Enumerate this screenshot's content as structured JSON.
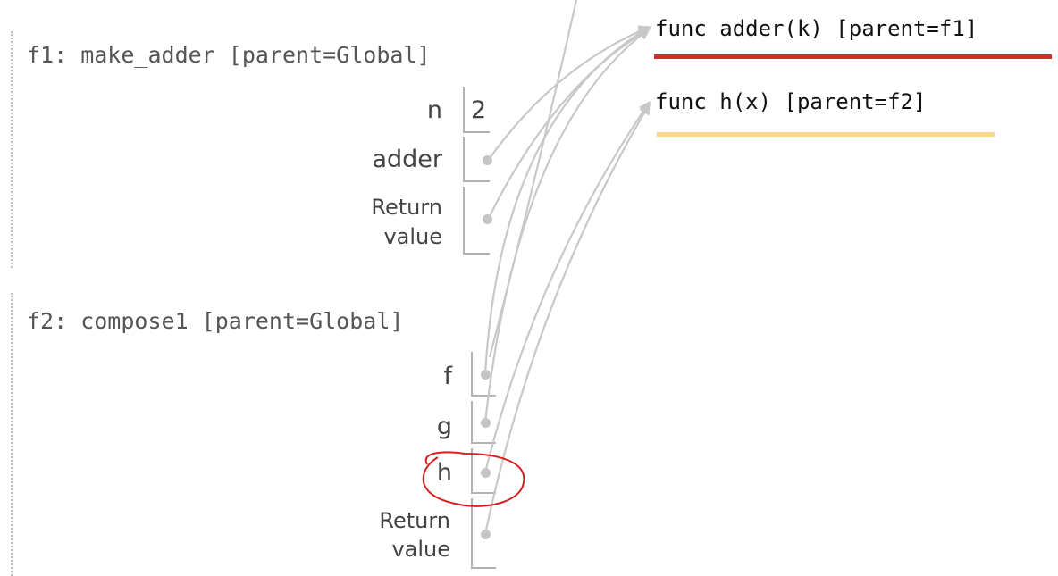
{
  "objects": [
    {
      "label": "func adder(k) [parent=f1]",
      "underline_color": "#d0302a"
    },
    {
      "label": "func h(x) [parent=f2]",
      "underline_color": "#f6d98a"
    }
  ],
  "frames": [
    {
      "title": "f1: make_adder [parent=Global]",
      "vars": [
        {
          "name": "n",
          "value": "2"
        },
        {
          "name": "adder"
        },
        {
          "name_line1": "Return",
          "name_line2": "value"
        }
      ]
    },
    {
      "title": "f2: compose1 [parent=Global]",
      "vars": [
        {
          "name": "f"
        },
        {
          "name": "g"
        },
        {
          "name": "h"
        },
        {
          "name_line1": "Return",
          "name_line2": "value"
        }
      ]
    }
  ],
  "colors": {
    "arrow": "#c8c8c8",
    "highlight_circle": "#d62020"
  }
}
